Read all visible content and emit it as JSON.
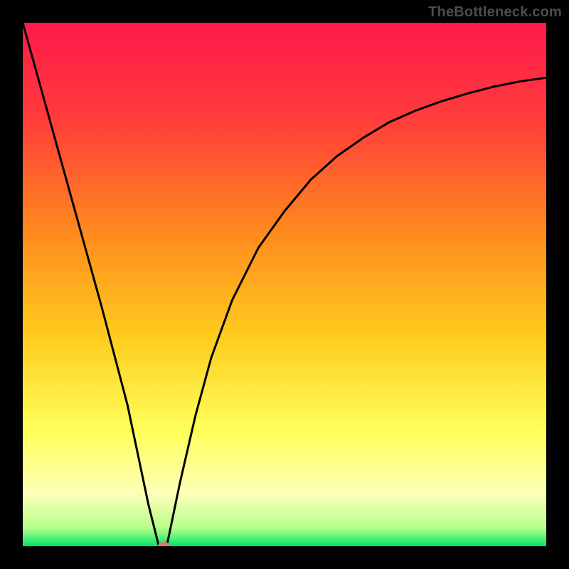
{
  "attribution": "TheBottleneck.com",
  "chart_data": {
    "type": "line",
    "title": "",
    "xlabel": "",
    "ylabel": "",
    "xlim": [
      0,
      100
    ],
    "ylim": [
      0,
      100
    ],
    "series": [
      {
        "name": "curve",
        "x": [
          0,
          5,
          10,
          15,
          20,
          24,
          26,
          27.5,
          30,
          33,
          36,
          40,
          45,
          50,
          55,
          60,
          65,
          70,
          75,
          80,
          85,
          90,
          95,
          100
        ],
        "y": [
          100,
          82,
          64,
          46,
          27,
          8,
          0,
          0,
          12,
          25,
          36,
          47,
          57,
          64,
          70,
          74.5,
          78,
          81,
          83.2,
          85,
          86.5,
          87.8,
          88.8,
          89.5
        ]
      }
    ],
    "marker": {
      "x": 27,
      "y": 0,
      "color": "#d77877",
      "rx": 9,
      "ry": 6
    },
    "background_gradient": {
      "stops": [
        {
          "offset": 0.0,
          "color": "#ff1a4a"
        },
        {
          "offset": 0.18,
          "color": "#ff3b3b"
        },
        {
          "offset": 0.4,
          "color": "#ff8a1e"
        },
        {
          "offset": 0.6,
          "color": "#ffcc1e"
        },
        {
          "offset": 0.78,
          "color": "#ffff5a"
        },
        {
          "offset": 0.9,
          "color": "#fdffb8"
        },
        {
          "offset": 0.965,
          "color": "#b7ff8a"
        },
        {
          "offset": 1.0,
          "color": "#00e56b"
        }
      ]
    },
    "colors": {
      "curve": "#000000",
      "frame": "#000000"
    }
  }
}
